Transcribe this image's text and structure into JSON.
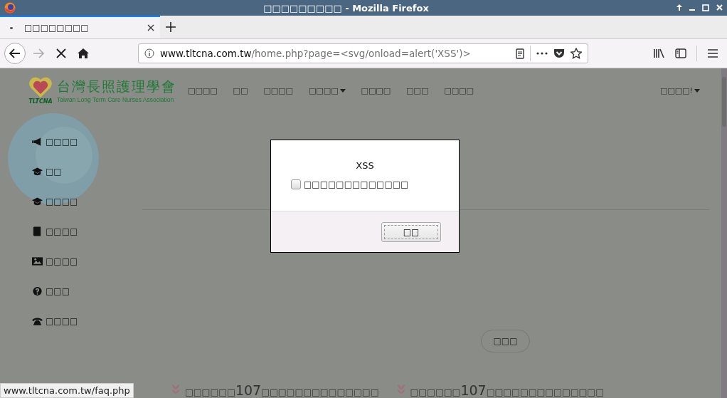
{
  "window": {
    "title": "□□□□□□□□□ - Mozilla Firefox"
  },
  "tabs": [
    {
      "label": "□□□□□□□□",
      "selected": true
    }
  ],
  "toolbar": {
    "url_domain": "www.tltcna.com.tw",
    "url_path": "/home.php?page=<svg/onload=alert('XSS')>",
    "loading": true
  },
  "site": {
    "logo_title": "台灣長照護理學會",
    "logo_subtitle": "Taiwan Long Term Care Nurses Association",
    "logo_mark": "TLTCNA",
    "nav": [
      {
        "label": "□□□□",
        "dropdown": false
      },
      {
        "label": "□□",
        "dropdown": false
      },
      {
        "label": "□□□□",
        "dropdown": false
      },
      {
        "label": "□□□□",
        "dropdown": true
      },
      {
        "label": "□□□□",
        "dropdown": false
      },
      {
        "label": "□□□",
        "dropdown": false
      },
      {
        "label": "□□□□",
        "dropdown": false
      }
    ],
    "user_menu": {
      "label": "□□□□!",
      "dropdown": true
    },
    "sidebar": [
      {
        "label": "□□□□",
        "kind": "megaphone"
      },
      {
        "label": "□□",
        "kind": "cap"
      },
      {
        "label": "□□□□",
        "kind": "cap"
      },
      {
        "label": "□□□□",
        "kind": "book"
      },
      {
        "label": "□□□□",
        "kind": "image"
      },
      {
        "label": "□□□",
        "kind": "question"
      },
      {
        "label": "□□□□",
        "kind": "phone"
      }
    ],
    "more_button": "□□□",
    "headlines": [
      {
        "prefix": "□□□□□□",
        "number": "107",
        "suffix": "□□□□□□□□□□□□□□"
      },
      {
        "prefix": "□□□□□□",
        "number": "107",
        "suffix": "□□□□□□□□□□□□□□"
      }
    ]
  },
  "dialog": {
    "title": "XSS",
    "checkbox": {
      "label": "□□□□□□□□□□□□□",
      "checked": false
    },
    "button": "□□"
  },
  "status_bar": "www.tltcna.com.tw/faq.php"
}
